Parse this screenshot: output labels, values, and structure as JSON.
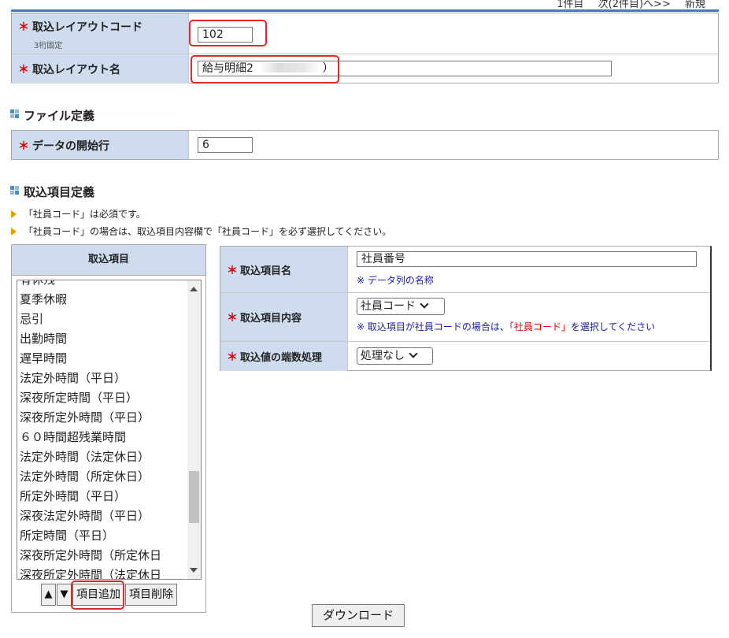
{
  "pager": {
    "count": "1件目",
    "next": "次(2件目)へ>>",
    "new": "新規"
  },
  "layout_form": {
    "code_label": "取込レイアウトコード",
    "code_sublabel": "3桁固定",
    "code_value": "102",
    "name_label": "取込レイアウト名",
    "name_value": "給与明細2",
    "name_suffix": "）"
  },
  "file_def": {
    "title": "ファイル定義",
    "start_row_label": "データの開始行",
    "start_row_value": "6"
  },
  "item_def": {
    "title": "取込項目定義",
    "notes": [
      "「社員コード」は必須です。",
      "「社員コード」の場合は、取込項目内容欄で「社員コード」を必ず選択してください。"
    ]
  },
  "item_list": {
    "header": "取込項目",
    "items": [
      "有休残",
      "夏季休暇",
      "忌引",
      "出勤時間",
      "遅早時間",
      "法定外時間（平日）",
      "深夜所定時間（平日）",
      "深夜所定外時間（平日）",
      "６０時間超残業時間",
      "法定外時間（法定休日）",
      "法定外時間（所定休日）",
      "所定外時間（平日）",
      "深夜法定外時間（平日）",
      "所定時間（平日）",
      "深夜所定外時間（所定休日",
      "深夜所定外時間（法定休日"
    ],
    "up_label": "▲",
    "down_label": "▼",
    "add_label": "項目追加",
    "delete_label": "項目削除"
  },
  "item_detail": {
    "name_label": "取込項目名",
    "name_value": "社員番号",
    "name_hint": "※ データ列の名称",
    "content_label": "取込項目内容",
    "content_value": "社員コード",
    "content_hint_pre": "※ 取込項目が社員コードの場合は、",
    "content_hint_red": "「社員コード」",
    "content_hint_post": "を選択してください",
    "rounding_label": "取込値の端数処理",
    "rounding_value": "処理なし"
  },
  "download_label": "ダウンロード",
  "required_mark": "＊",
  "colors": {
    "label_bg": "#cfdcee",
    "required": "#e00000",
    "hint": "#1a1ab0",
    "highlight": "#e32626",
    "note_arrow": "#f09a00",
    "top_line": "#4a7ab5"
  }
}
